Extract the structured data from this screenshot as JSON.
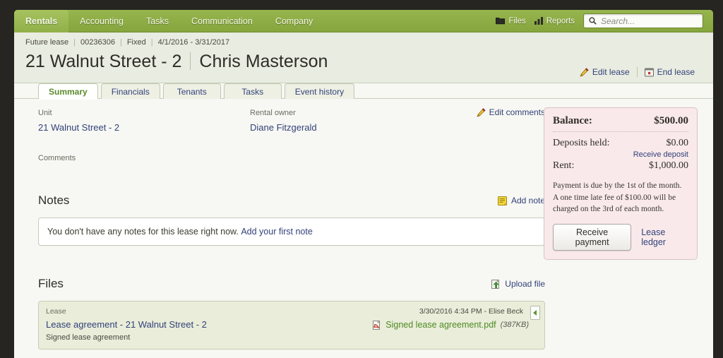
{
  "topnav": {
    "items": [
      {
        "label": "Rentals",
        "active": true
      },
      {
        "label": "Accounting",
        "active": false
      },
      {
        "label": "Tasks",
        "active": false
      },
      {
        "label": "Communication",
        "active": false
      },
      {
        "label": "Company",
        "active": false
      }
    ],
    "files_label": "Files",
    "files_icon": "folder-icon",
    "reports_label": "Reports",
    "reports_icon": "bar-chart-icon",
    "search": {
      "placeholder": "Search...",
      "value": "",
      "icon": "search-icon"
    },
    "accent_color": "#8ead45"
  },
  "header": {
    "breadcrumb": {
      "status": "Future lease",
      "lease_number": "00236306",
      "lease_type": "Fixed",
      "date_range": "4/1/2016 - 3/31/2017"
    },
    "title_property": "21 Walnut Street - 2",
    "title_tenant": "Chris Masterson",
    "actions": [
      {
        "label": "Edit lease",
        "icon": "pencil-icon"
      },
      {
        "label": "End lease",
        "icon": "calendar-end-icon"
      }
    ]
  },
  "tabs": [
    {
      "label": "Summary",
      "active": true
    },
    {
      "label": "Financials",
      "active": false
    },
    {
      "label": "Tenants",
      "active": false
    },
    {
      "label": "Tasks",
      "active": false
    },
    {
      "label": "Event history",
      "active": false
    }
  ],
  "summary": {
    "unit_label": "Unit",
    "unit_value": "21 Walnut Street - 2",
    "owner_label": "Rental owner",
    "owner_value": "Diane Fitzgerald",
    "edit_comments_label": "Edit comments",
    "edit_comments_icon": "pencil-icon",
    "comments_label": "Comments",
    "comments_value": ""
  },
  "notes": {
    "title": "Notes",
    "add_label": "Add note",
    "add_icon": "note-icon",
    "empty_text": "You don't have any notes for this lease right now.",
    "empty_link": "Add your first note"
  },
  "files": {
    "title": "Files",
    "upload_label": "Upload file",
    "upload_icon": "upload-icon",
    "rows": [
      {
        "category": "Lease",
        "title": "Lease agreement - 21 Walnut Street - 2",
        "description": "Signed lease agreement",
        "meta": "3/30/2016 4:34 PM - Elise Beck",
        "attachment_name": "Signed lease agreement.pdf",
        "attachment_size": "(387KB)",
        "attachment_icon": "pdf-icon",
        "collapse_icon": "triangle-left-icon"
      }
    ]
  },
  "balance_panel": {
    "balance_label": "Balance:",
    "balance_value": "$500.00",
    "deposits_label": "Deposits held:",
    "deposits_value": "$0.00",
    "receive_deposit_link": "Receive deposit",
    "rent_label": "Rent:",
    "rent_value": "$1,000.00",
    "note": "Payment is due by the 1st of the month. A one time late fee of $100.00 will be charged on the 3rd of each month.",
    "receive_payment_button": "Receive payment",
    "lease_ledger_link": "Lease ledger",
    "background_color": "#f9e9ea"
  }
}
